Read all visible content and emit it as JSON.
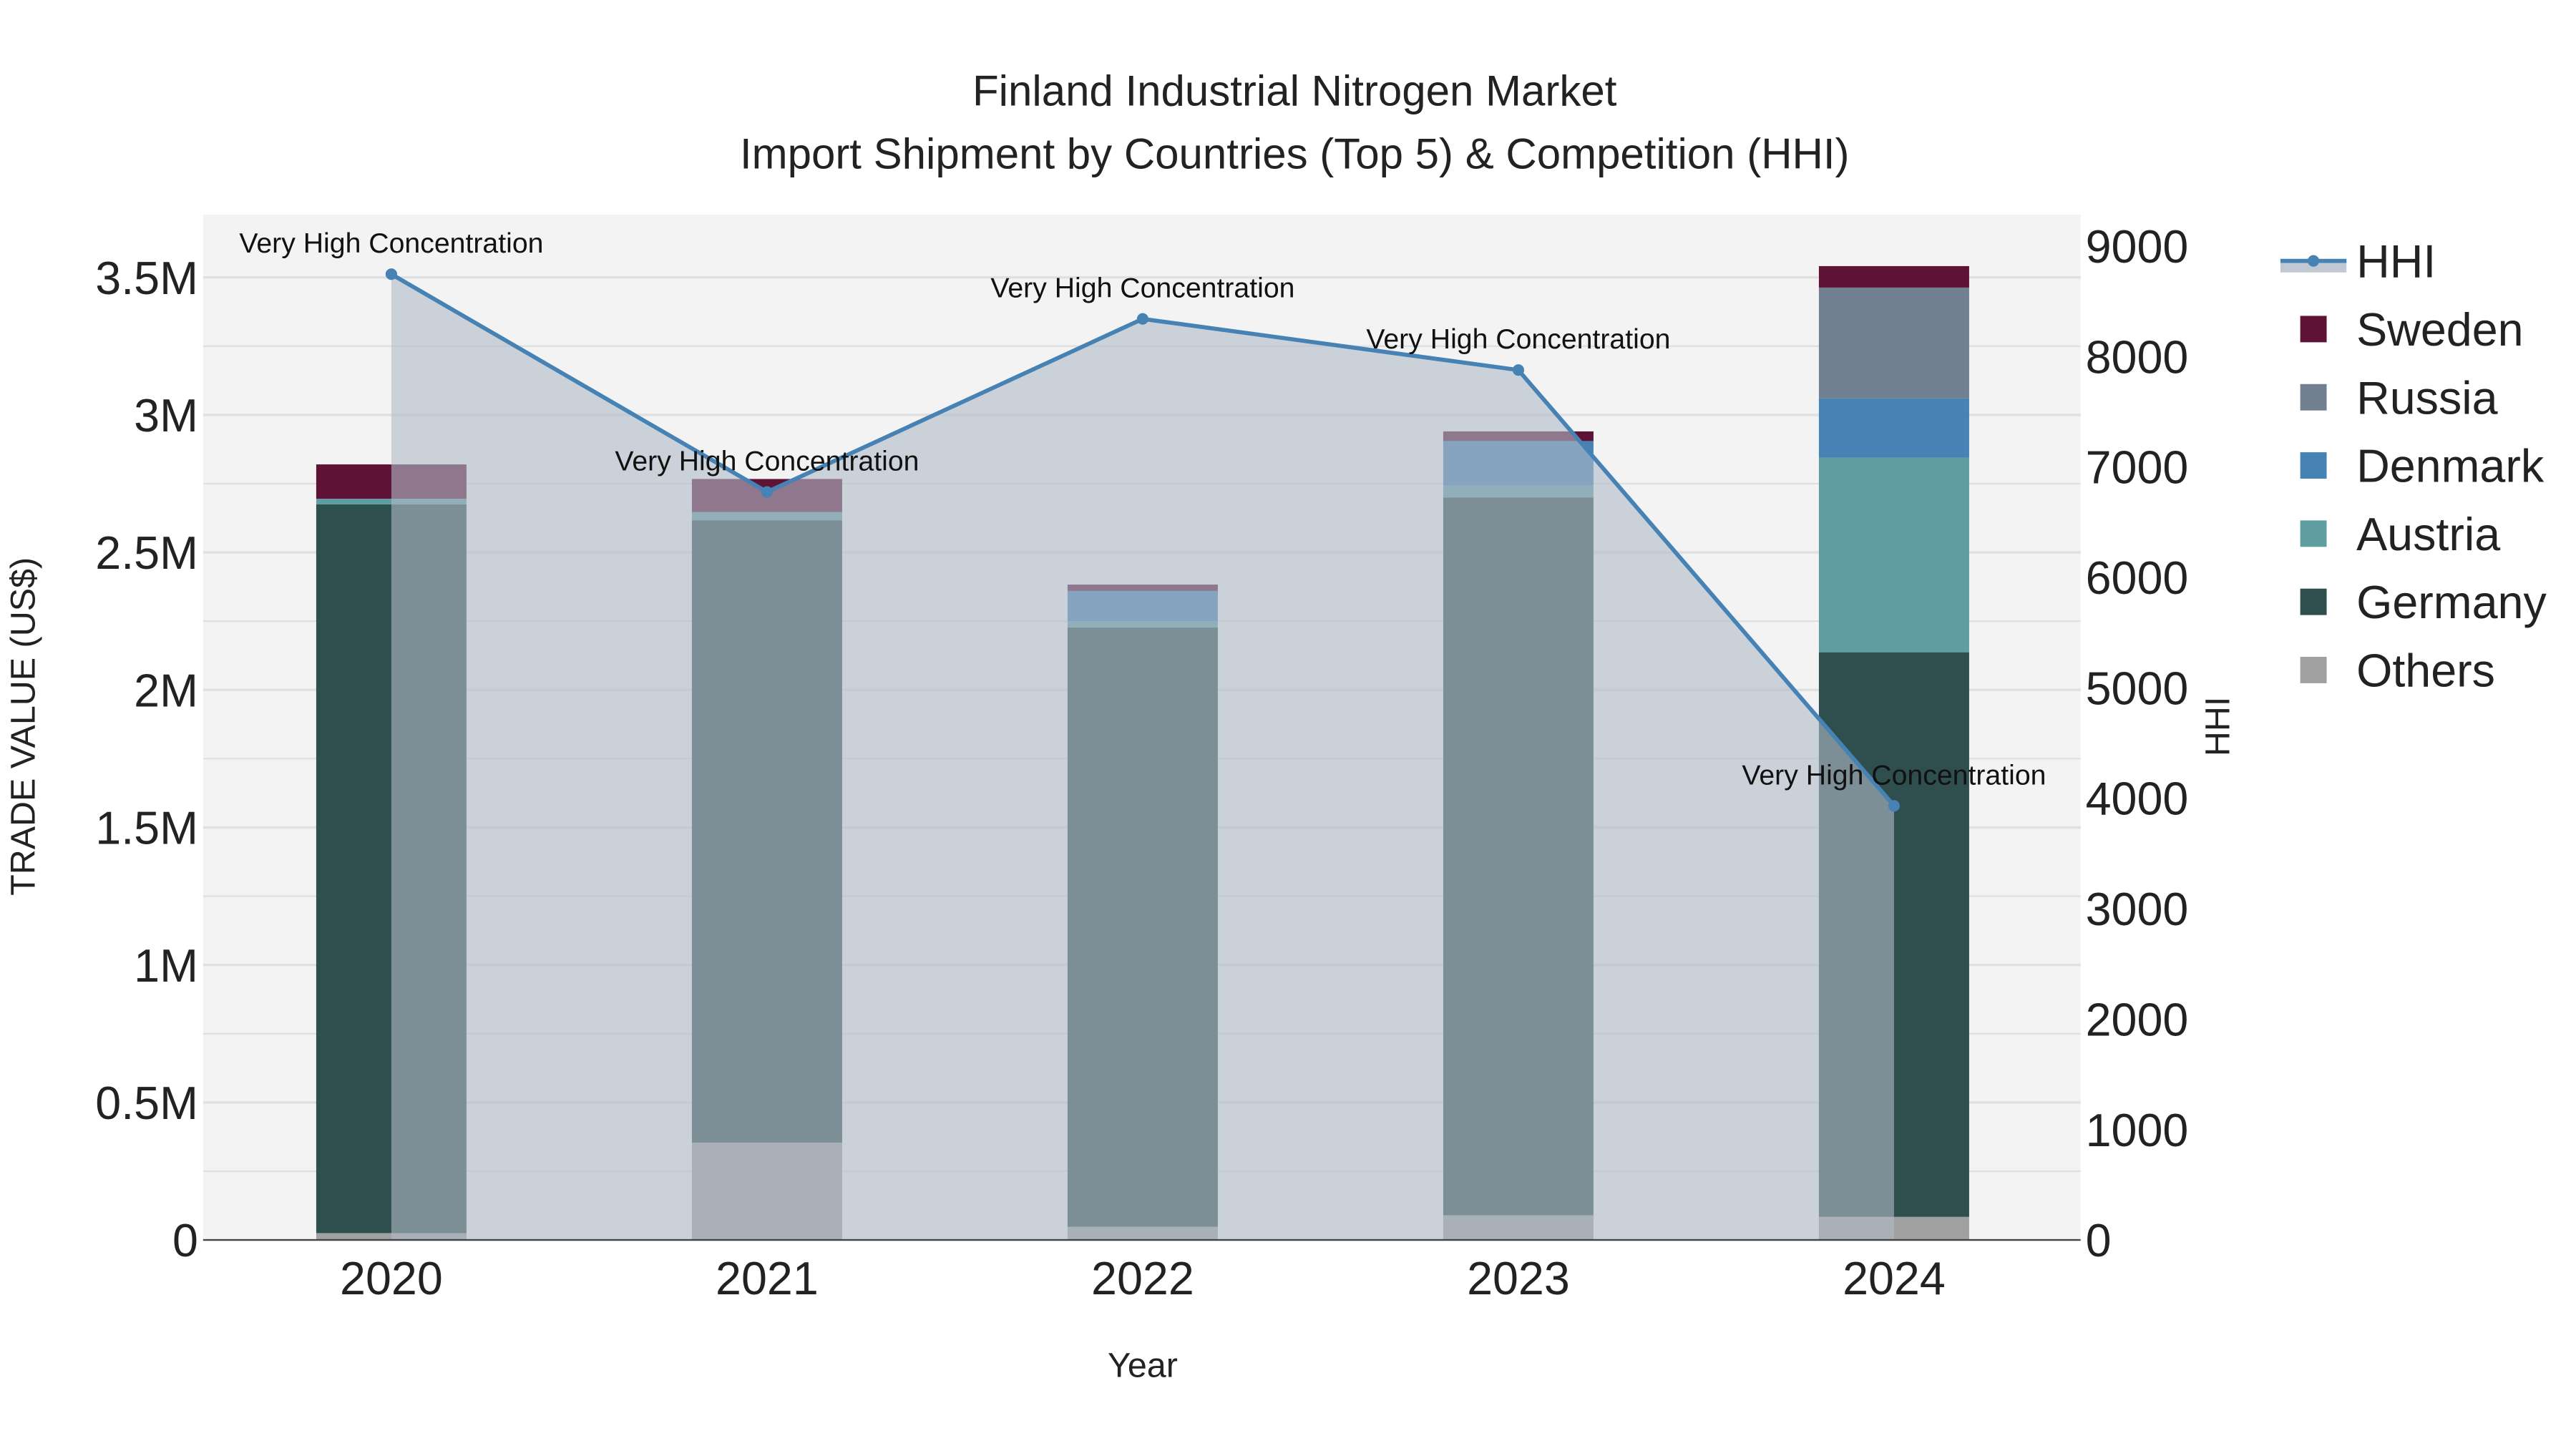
{
  "chart_data": {
    "type": "bar",
    "title": "Finland Industrial Nitrogen Market",
    "subtitle": "Import Shipment by Countries (Top 5) & Competition (HHI)",
    "xlabel": "Year",
    "ylabel": "TRADE VALUE (US$)",
    "y2label": "HHI",
    "categories": [
      "2020",
      "2021",
      "2022",
      "2023",
      "2024"
    ],
    "ylim": [
      0,
      3.7
    ],
    "y_ticks": [
      "0",
      "0.5M",
      "1M",
      "1.5M",
      "2M",
      "2.5M",
      "3M",
      "3.5M"
    ],
    "y2lim": [
      0,
      9250
    ],
    "y2_ticks": [
      "0",
      "1000",
      "2000",
      "3000",
      "4000",
      "5000",
      "6000",
      "7000",
      "8000",
      "9000"
    ],
    "unit": "million US$",
    "series": [
      {
        "name": "Others",
        "color": "#a0a0a0",
        "values": [
          0.025,
          0.354,
          0.048,
          0.09,
          0.084
        ]
      },
      {
        "name": "Germany",
        "color": "#2f4f4f",
        "values": [
          2.65,
          2.263,
          2.179,
          2.61,
          2.053
        ]
      },
      {
        "name": "Austria",
        "color": "#5f9ea0",
        "values": [
          0.02,
          0.03,
          0.023,
          0.043,
          0.708
        ]
      },
      {
        "name": "Denmark",
        "color": "#4682b4",
        "values": [
          0,
          0,
          0.11,
          0.162,
          0.215
        ]
      },
      {
        "name": "Russia",
        "color": "#708090",
        "values": [
          0,
          0,
          0,
          0,
          0.403
        ]
      },
      {
        "name": "Sweden",
        "color": "#5e1336",
        "values": [
          0.125,
          0.12,
          0.023,
          0.035,
          0.078
        ]
      }
    ],
    "hhi": {
      "name": "HHI",
      "color": "#4682b4",
      "values": [
        8745,
        6773,
        8340,
        7877,
        3931
      ],
      "annotations": [
        "Very High Concentration",
        "Very High Concentration",
        "Very High Concentration",
        "Very High Concentration",
        "Very High Concentration"
      ]
    },
    "legend": [
      "HHI",
      "Sweden",
      "Russia",
      "Denmark",
      "Austria",
      "Germany",
      "Others"
    ],
    "legend_position": "right",
    "grid": true
  }
}
